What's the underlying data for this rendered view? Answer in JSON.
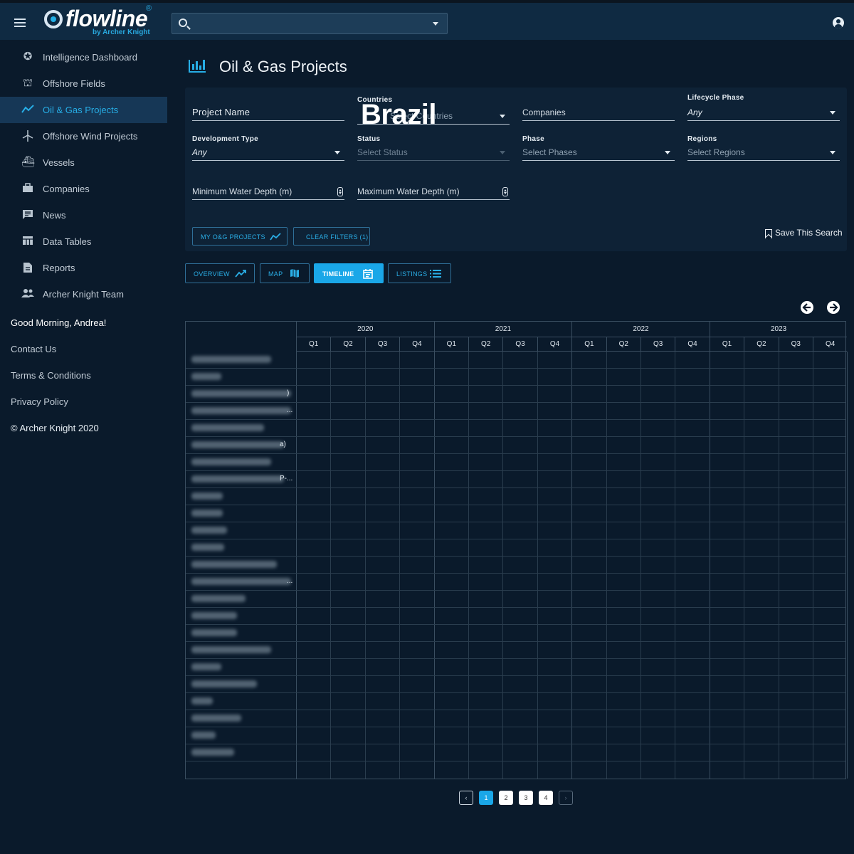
{
  "app": {
    "brand": "flowline",
    "brand_sub": "by Archer Knight",
    "brand_reg": "®"
  },
  "search": {
    "placeholder": ""
  },
  "sidebar": {
    "items": [
      {
        "label": "Intelligence Dashboard",
        "icon": "star-badge-icon",
        "active": false
      },
      {
        "label": "Offshore Fields",
        "icon": "oil-rig-icon",
        "active": false
      },
      {
        "label": "Oil & Gas Projects",
        "icon": "trend-line-icon",
        "active": true
      },
      {
        "label": "Offshore Wind Projects",
        "icon": "wind-turbine-icon",
        "active": false
      },
      {
        "label": "Vessels",
        "icon": "ship-icon",
        "active": false
      },
      {
        "label": "Companies",
        "icon": "briefcase-icon",
        "active": false
      },
      {
        "label": "News",
        "icon": "news-icon",
        "active": false
      },
      {
        "label": "Data Tables",
        "icon": "table-icon",
        "active": false
      },
      {
        "label": "Reports",
        "icon": "document-icon",
        "active": false
      },
      {
        "label": "Archer Knight Team",
        "icon": "team-icon",
        "active": false
      }
    ],
    "greeting": "Good Morning, Andrea!",
    "contact": "Contact Us",
    "terms": "Terms & Conditions",
    "privacy": "Privacy Policy",
    "copyright": "© Archer Knight 2020"
  },
  "page": {
    "title": "Oil & Gas Projects"
  },
  "filters": {
    "project_name": "Project Name",
    "countries_label": "Countries",
    "countries_placeholder": "Select Countries",
    "countries_overlay": "Brazil",
    "companies": "Companies",
    "lifecycle_label": "Lifecycle Phase",
    "lifecycle_value": "Any",
    "devtype_label": "Development Type",
    "devtype_value": "Any",
    "status_label": "Status",
    "status_placeholder": "Select Status",
    "phase_label": "Phase",
    "phase_placeholder": "Select Phases",
    "regions_label": "Regions",
    "regions_placeholder": "Select Regions",
    "min_depth": "Minimum Water Depth (m)",
    "max_depth": "Maximum Water Depth (m)",
    "my_projects_btn": "MY O&G PROJECTS",
    "clear_btn": "CLEAR FILTERS (1)",
    "save_search": "Save This Search"
  },
  "views": {
    "overview": "OVERVIEW",
    "map": "MAP",
    "timeline": "TIMELINE",
    "listings": "LISTINGS",
    "active": "timeline"
  },
  "timeline": {
    "years": [
      "2020",
      "2021",
      "2022",
      "2023"
    ],
    "quarters": [
      "Q1",
      "Q2",
      "Q3",
      "Q4"
    ],
    "rows": [
      {
        "suffix": ""
      },
      {
        "suffix": ""
      },
      {
        "suffix": ")"
      },
      {
        "suffix": "..."
      },
      {
        "suffix": ""
      },
      {
        "suffix": "a)"
      },
      {
        "suffix": ""
      },
      {
        "suffix": "P-..."
      },
      {
        "suffix": ""
      },
      {
        "suffix": ""
      },
      {
        "suffix": ""
      },
      {
        "suffix": ""
      },
      {
        "suffix": ""
      },
      {
        "suffix": "..."
      },
      {
        "suffix": ""
      },
      {
        "suffix": ""
      },
      {
        "suffix": ""
      },
      {
        "suffix": ""
      },
      {
        "suffix": ""
      },
      {
        "suffix": ""
      },
      {
        "suffix": ""
      },
      {
        "suffix": ""
      },
      {
        "suffix": ""
      },
      {
        "suffix": ""
      }
    ]
  },
  "pagination": {
    "prev": "‹",
    "pages": [
      "1",
      "2",
      "3",
      "4"
    ],
    "current": "1",
    "next": "›"
  },
  "colors": {
    "accent": "#1aa7e8",
    "background": "#0a1a2b",
    "topbar": "#0f2a42"
  }
}
